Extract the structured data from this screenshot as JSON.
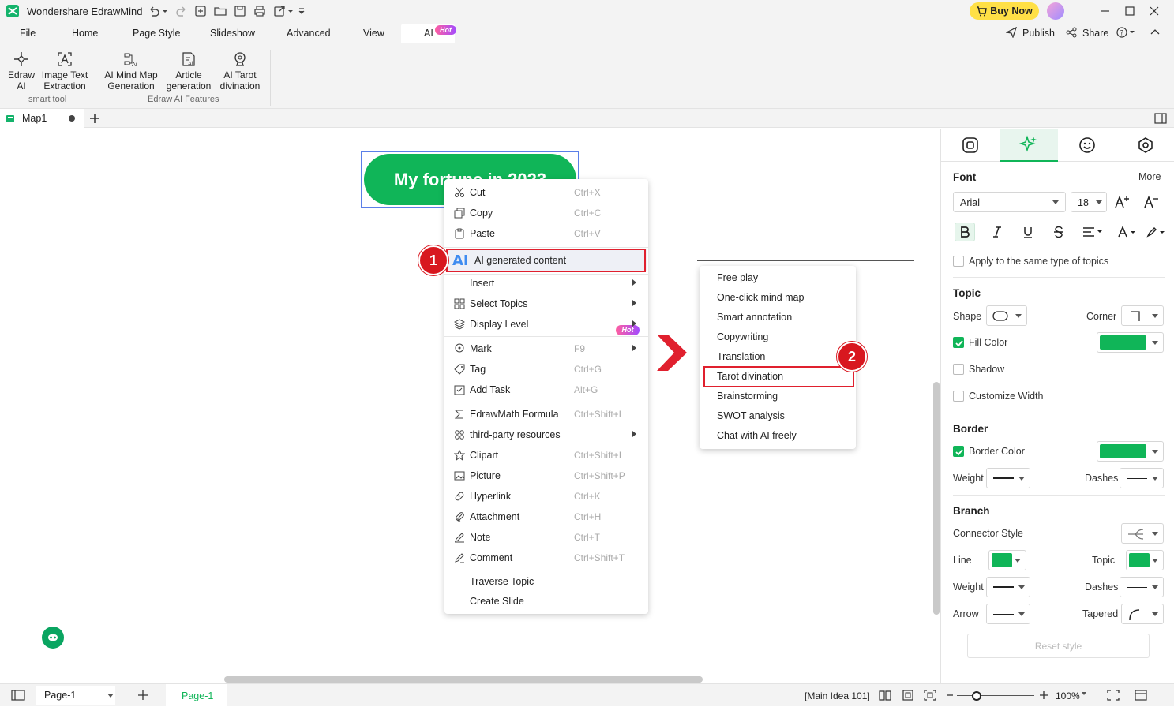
{
  "app": {
    "title": "Wondershare EdrawMind"
  },
  "titlebar": {
    "buy_now": "Buy Now"
  },
  "menu": {
    "tabs": [
      "File",
      "Home",
      "Page Style",
      "Slideshow",
      "Advanced",
      "View",
      "AI"
    ],
    "ai_badge": "Hot",
    "publish": "Publish",
    "share": "Share"
  },
  "ribbon": {
    "buttons": [
      {
        "line1": "Edraw",
        "line2": "AI",
        "icon": "edraw-ai-icon"
      },
      {
        "line1": "Image Text",
        "line2": "Extraction",
        "icon": "image-text-icon"
      },
      {
        "line1": "AI Mind Map",
        "line2": "Generation",
        "icon": "ai-mindmap-icon"
      },
      {
        "line1": "Article",
        "line2": "generation",
        "icon": "article-icon"
      },
      {
        "line1": "AI Tarot",
        "line2": "divination",
        "icon": "tarot-icon"
      }
    ],
    "groups": [
      "smart tool",
      "Edraw AI Features"
    ]
  },
  "doc_tab": {
    "name": "Map1"
  },
  "canvas": {
    "topic_text": "My fortune in 2023"
  },
  "context_menu": {
    "items": [
      {
        "label": "Cut",
        "shortcut": "Ctrl+X"
      },
      {
        "label": "Copy",
        "shortcut": "Ctrl+C"
      },
      {
        "label": "Paste",
        "shortcut": "Ctrl+V"
      },
      {
        "label": "AI generated content",
        "shortcut": "",
        "badge": "Hot"
      },
      {
        "label": "Insert",
        "shortcut": ""
      },
      {
        "label": "Select Topics",
        "shortcut": ""
      },
      {
        "label": "Display Level",
        "shortcut": ""
      },
      {
        "label": "Mark",
        "shortcut": "F9"
      },
      {
        "label": "Tag",
        "shortcut": "Ctrl+G"
      },
      {
        "label": "Add Task",
        "shortcut": "Alt+G"
      },
      {
        "label": "EdrawMath Formula",
        "shortcut": "Ctrl+Shift+L"
      },
      {
        "label": "third-party resources",
        "shortcut": ""
      },
      {
        "label": "Clipart",
        "shortcut": "Ctrl+Shift+I"
      },
      {
        "label": "Picture",
        "shortcut": "Ctrl+Shift+P"
      },
      {
        "label": "Hyperlink",
        "shortcut": "Ctrl+K"
      },
      {
        "label": "Attachment",
        "shortcut": "Ctrl+H"
      },
      {
        "label": "Note",
        "shortcut": "Ctrl+T"
      },
      {
        "label": "Comment",
        "shortcut": "Ctrl+Shift+T"
      },
      {
        "label": "Traverse Topic",
        "shortcut": ""
      },
      {
        "label": "Create Slide",
        "shortcut": ""
      }
    ]
  },
  "submenu": {
    "items": [
      "Free play",
      "One-click mind map",
      "Smart annotation",
      "Copywriting",
      "Translation",
      "Tarot divination",
      "Brainstorming",
      "SWOT analysis",
      "Chat with AI freely"
    ]
  },
  "steps": [
    "1",
    "2"
  ],
  "panel": {
    "font": {
      "title": "Font",
      "more": "More",
      "family": "Arial",
      "size": "18",
      "apply_same": "Apply to the same type of topics"
    },
    "topic": {
      "title": "Topic",
      "shape_label": "Shape",
      "corner_label": "Corner",
      "fill_color_label": "Fill Color",
      "shadow_label": "Shadow",
      "customize_width_label": "Customize Width"
    },
    "border": {
      "title": "Border",
      "color_label": "Border Color",
      "weight_label": "Weight",
      "dashes_label": "Dashes"
    },
    "branch": {
      "title": "Branch",
      "connector_label": "Connector Style",
      "line_label": "Line",
      "topic_label": "Topic",
      "weight_label": "Weight",
      "dashes_label": "Dashes",
      "arrow_label": "Arrow",
      "tapered_label": "Tapered"
    },
    "reset": "Reset style",
    "accent": "#10b558"
  },
  "status": {
    "page_select": "Page-1",
    "page_tab": "Page-1",
    "main_idea": "[Main Idea 101]",
    "zoom": "100%"
  }
}
